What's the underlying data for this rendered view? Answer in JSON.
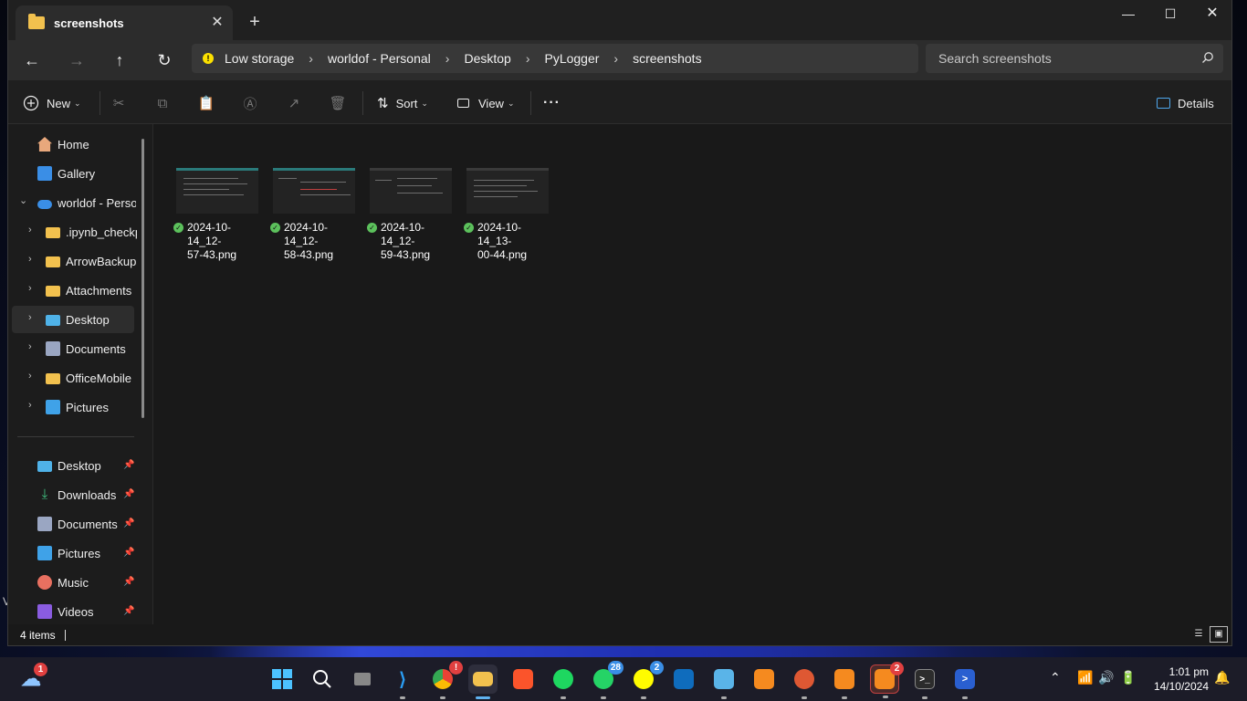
{
  "window": {
    "tab_title": "screenshots",
    "close_tab_glyph": "✕",
    "new_tab_glyph": "+",
    "minimize_glyph": "—",
    "maximize_glyph": "☐",
    "close_glyph": "✕"
  },
  "navigation": {
    "back_glyph": "←",
    "forward_glyph": "→",
    "up_glyph": "↑",
    "refresh_glyph": "↻",
    "warning_glyph": "!",
    "breadcrumbs": [
      "Low storage",
      "worldof - Personal",
      "Desktop",
      "PyLogger",
      "screenshots"
    ],
    "separator": "›",
    "search_placeholder": "Search screenshots"
  },
  "toolbar": {
    "new_label": "New",
    "sort_label": "Sort",
    "view_label": "View",
    "more_glyph": "···",
    "details_label": "Details",
    "icons": [
      "cut-icon",
      "copy-icon",
      "paste-icon",
      "rename-icon",
      "share-icon",
      "delete-icon"
    ]
  },
  "sidebar": {
    "items": [
      {
        "label": "Home",
        "icon": "home-icon"
      },
      {
        "label": "Gallery",
        "icon": "gallery-icon"
      },
      {
        "label": "worldof - Personal",
        "icon": "onedrive-icon"
      },
      {
        "label": ".ipynb_checkpoints",
        "icon": "folder-icon"
      },
      {
        "label": "ArrowBackup",
        "icon": "folder-icon"
      },
      {
        "label": "Attachments",
        "icon": "folder-icon"
      },
      {
        "label": "Desktop",
        "icon": "desktop-icon"
      },
      {
        "label": "Documents",
        "icon": "documents-icon"
      },
      {
        "label": "OfficeMobile",
        "icon": "folder-icon"
      },
      {
        "label": "Pictures",
        "icon": "pictures-icon"
      }
    ],
    "quick_access": [
      {
        "label": "Desktop",
        "icon": "desktop-icon"
      },
      {
        "label": "Downloads",
        "icon": "downloads-icon"
      },
      {
        "label": "Documents",
        "icon": "documents-icon"
      },
      {
        "label": "Pictures",
        "icon": "pictures-icon"
      },
      {
        "label": "Music",
        "icon": "music-icon"
      },
      {
        "label": "Videos",
        "icon": "videos-icon"
      }
    ],
    "expand_glyph": "›",
    "collapse_glyph": "⌄",
    "pin_glyph": "📌"
  },
  "files": [
    {
      "line1": "2024-10-14_12-",
      "line2": "57-43.png"
    },
    {
      "line1": "2024-10-14_12-",
      "line2": "58-43.png"
    },
    {
      "line1": "2024-10-14_12-",
      "line2": "59-43.png"
    },
    {
      "line1": "2024-10-14_13-",
      "line2": "00-44.png"
    }
  ],
  "status": {
    "item_count": "4 items"
  },
  "desktop": {
    "fragment": "V"
  },
  "taskbar": {
    "weather_badge": "1",
    "chrome_badge": "!",
    "whatsapp_badge": "28",
    "snapchat_badge": "2",
    "active_app_badge": "2",
    "time": "1:01 pm",
    "date": "14/10/2024"
  },
  "colors": {
    "accent": "#5fb2f0",
    "folder": "#f2c14e",
    "badge_red": "#e04040",
    "badge_blue": "#3a8ee6",
    "sync_green": "#5cc15c"
  }
}
